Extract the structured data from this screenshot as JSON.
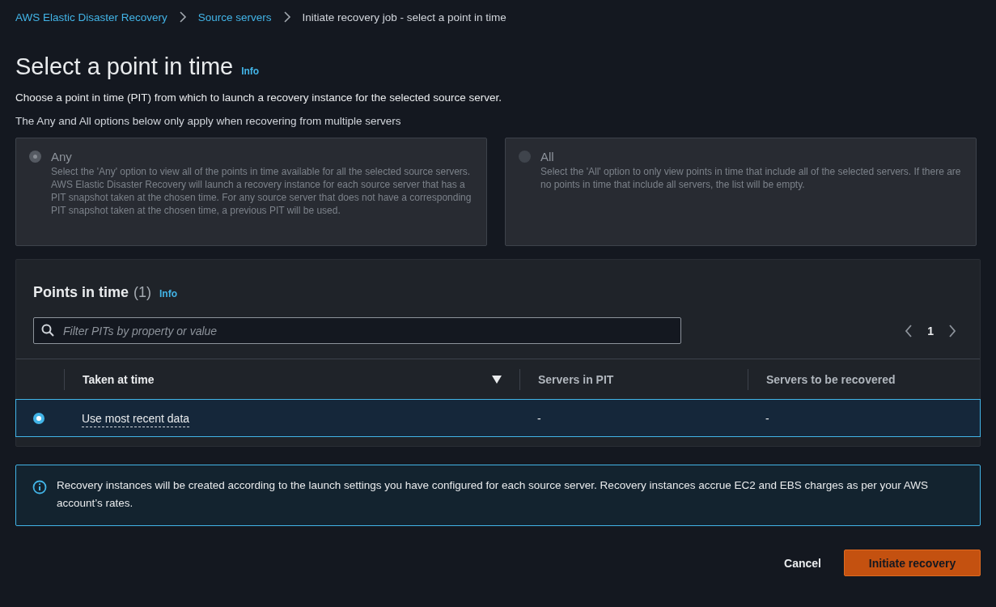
{
  "breadcrumbs": [
    {
      "label": "AWS Elastic Disaster Recovery",
      "link": true
    },
    {
      "label": "Source servers",
      "link": true
    },
    {
      "label": "Initiate recovery job - select a point in time",
      "link": false
    }
  ],
  "header": {
    "title": "Select a point in time",
    "info": "Info",
    "description": "Choose a point in time (PIT) from which to launch a recovery instance for the selected source server.",
    "note": "The Any and All options below only apply when recovering from multiple servers"
  },
  "options": [
    {
      "label": "Any",
      "description": "Select the 'Any' option to view all of the points in time available for all the selected source servers. AWS Elastic Disaster Recovery will launch a recovery instance for each source server that has a PIT snapshot taken at the chosen time. For any source server that does not have a corresponding PIT snapshot taken at the chosen time, a previous PIT will be used.",
      "selected": true,
      "disabled": true
    },
    {
      "label": "All",
      "description": "Select the 'All' option to only view points in time that include all of the selected servers. If there are no points in time that include all servers, the list will be empty.",
      "selected": false,
      "disabled": true
    }
  ],
  "table": {
    "title": "Points in time",
    "count": "(1)",
    "info": "Info",
    "search": {
      "placeholder": "Filter PITs by property or value"
    },
    "pagination": {
      "page": "1"
    },
    "columns": [
      {
        "label": "Taken at time",
        "sorted": true
      },
      {
        "label": "Servers in PIT",
        "sorted": false
      },
      {
        "label": "Servers to be recovered",
        "sorted": false
      }
    ],
    "rows": [
      {
        "selected": true,
        "cells": [
          "Use most recent data",
          "-",
          "-"
        ]
      }
    ]
  },
  "alert": {
    "text": "Recovery instances will be created according to the launch settings you have configured for each source server. Recovery instances accrue EC2 and EBS charges as per your AWS account’s rates."
  },
  "buttons": [
    {
      "label": "Cancel",
      "kind": "link"
    },
    {
      "label": "Initiate recovery",
      "kind": "primary"
    }
  ]
}
